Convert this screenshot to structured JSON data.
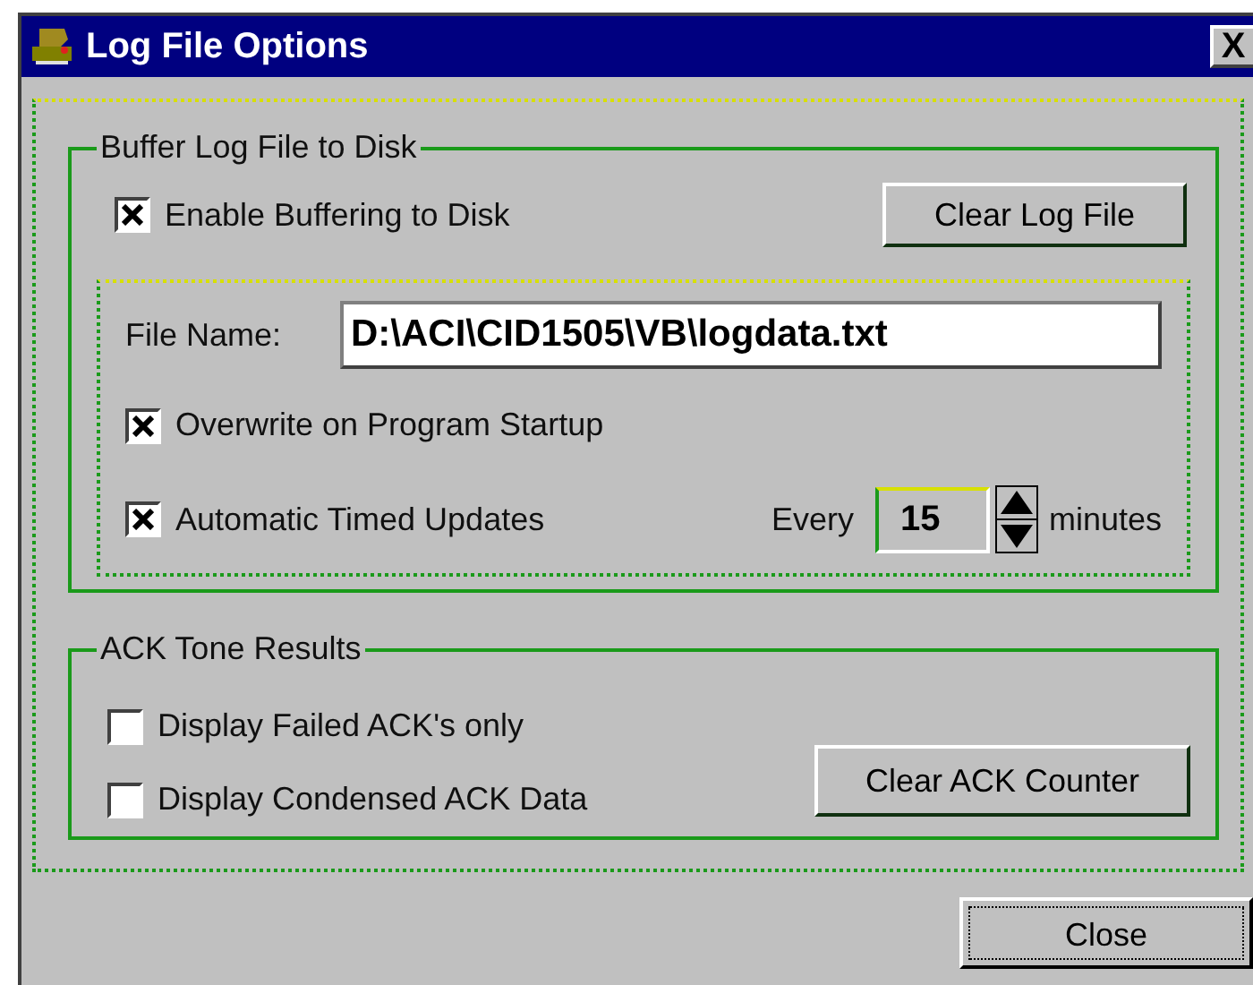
{
  "window": {
    "title": "Log File Options",
    "close": "X"
  },
  "buffer_group": {
    "legend": "Buffer Log File to Disk",
    "enable": {
      "label": "Enable Buffering to Disk",
      "checked": true
    },
    "clear_button": "Clear Log File",
    "file_name": {
      "label": "File Name:",
      "value": "D:\\ACI\\CID1505\\VB\\logdata.txt"
    },
    "options": [
      {
        "label": "Overwrite on Program Startup",
        "checked": true
      },
      {
        "label": "Automatic Timed Updates",
        "checked": true
      }
    ],
    "interval": {
      "prefix": "Every",
      "value": "15",
      "suffix": "minutes"
    }
  },
  "ack_group": {
    "legend": "ACK Tone Results",
    "options": [
      {
        "label": "Display Failed ACK's only",
        "checked": false
      },
      {
        "label": "Display Condensed ACK Data",
        "checked": false
      }
    ],
    "clear_button": "Clear ACK Counter"
  },
  "buttons": [
    {
      "label": "Close",
      "focused": true
    }
  ]
}
